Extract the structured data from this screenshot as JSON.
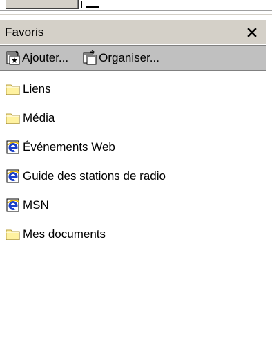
{
  "panel": {
    "title": "Favoris",
    "close_glyph": "✕"
  },
  "toolbar": {
    "add_label": "Ajouter...",
    "add_icon": "add-favorite-icon",
    "organize_label": "Organiser...",
    "organize_icon": "organize-favorites-icon"
  },
  "favorites": [
    {
      "label": "Liens",
      "icon": "folder-icon"
    },
    {
      "label": "Média",
      "icon": "folder-icon"
    },
    {
      "label": "Événements Web",
      "icon": "ie-link-icon"
    },
    {
      "label": "Guide des stations de radio",
      "icon": "ie-link-icon"
    },
    {
      "label": "MSN",
      "icon": "ie-link-icon"
    },
    {
      "label": "Mes documents",
      "icon": "folder-icon"
    }
  ],
  "colors": {
    "chrome_face": "#d4d0c8",
    "toolbar_face": "#c0c0c0",
    "folder_fill": "#fff2a0",
    "folder_edge": "#b8a040",
    "ie_blue": "#1a3fc8"
  }
}
